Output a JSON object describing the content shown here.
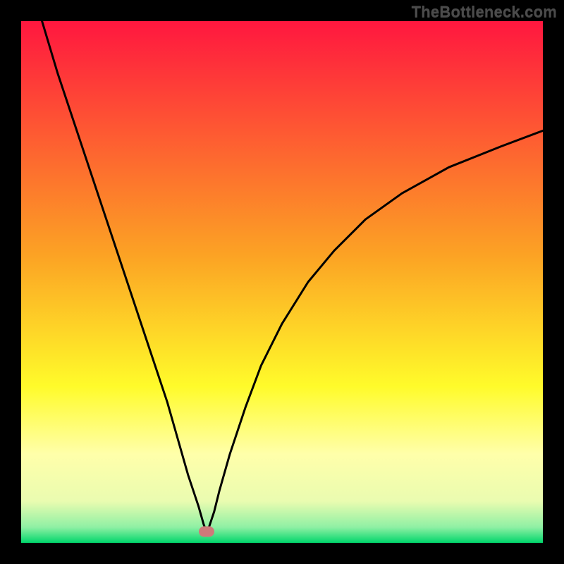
{
  "watermark": "TheBottleneck.com",
  "chart_data": {
    "type": "line",
    "title": "",
    "xlabel": "",
    "ylabel": "",
    "xlim": [
      0,
      100
    ],
    "ylim": [
      0,
      100
    ],
    "grid": false,
    "legend": false,
    "background_gradient": {
      "stops": [
        {
          "pos": 0.0,
          "color": "#ff173f"
        },
        {
          "pos": 0.45,
          "color": "#fca324"
        },
        {
          "pos": 0.7,
          "color": "#fffb2a"
        },
        {
          "pos": 0.83,
          "color": "#ffffaa"
        },
        {
          "pos": 0.92,
          "color": "#eafcb0"
        },
        {
          "pos": 0.97,
          "color": "#8ff0a4"
        },
        {
          "pos": 1.0,
          "color": "#00d66b"
        }
      ]
    },
    "series": [
      {
        "name": "bottleneck-curve",
        "x": [
          4,
          7,
          10,
          13,
          16,
          19,
          22,
          25,
          28,
          30,
          32,
          34,
          35,
          35.5,
          36,
          37,
          38,
          40,
          43,
          46,
          50,
          55,
          60,
          66,
          73,
          82,
          92,
          100
        ],
        "y": [
          100,
          90,
          81,
          72,
          63,
          54,
          45,
          36,
          27,
          20,
          13,
          7,
          3.5,
          2.2,
          3,
          6,
          10,
          17,
          26,
          34,
          42,
          50,
          56,
          62,
          67,
          72,
          76,
          79
        ]
      }
    ],
    "marker": {
      "x": 35.5,
      "y": 2.2,
      "color": "#cf7a7a"
    }
  }
}
